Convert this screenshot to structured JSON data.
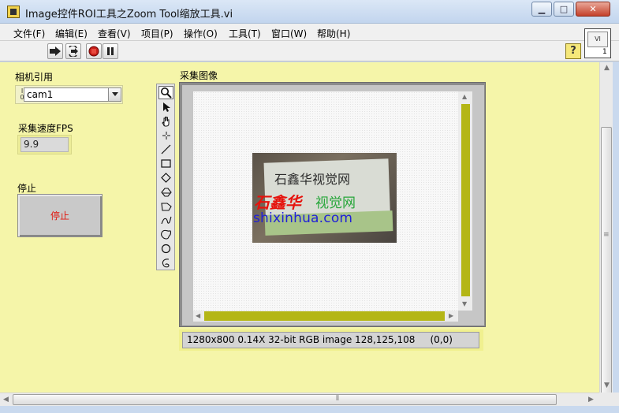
{
  "window": {
    "title": "Image控件ROI工具之Zoom Tool缩放工具.vi",
    "minimize": "▁",
    "maximize": "□",
    "close": "✕"
  },
  "menu": [
    {
      "label": "文件(F)"
    },
    {
      "label": "编辑(E)"
    },
    {
      "label": "查看(V)"
    },
    {
      "label": "项目(P)"
    },
    {
      "label": "操作(O)"
    },
    {
      "label": "工具(T)"
    },
    {
      "label": "窗口(W)"
    },
    {
      "label": "帮助(H)"
    }
  ],
  "toolbar": {
    "help_label": "?",
    "icons": [
      "run-arrow-icon",
      "run-continuously-icon",
      "abort-execution-icon",
      "pause-icon"
    ],
    "vi_icon_text": "1"
  },
  "controls": {
    "camera_label": "相机引用",
    "camera_io": "I/O",
    "camera_value": "cam1",
    "fps_label": "采集速度FPS",
    "fps_value": "9.9",
    "stop_label": "停止",
    "stop_button_text": "停止"
  },
  "display": {
    "label": "采集图像",
    "status": "1280x800 0.14X 32-bit RGB image 128,125,108     (0,0)",
    "palette_tools": [
      "zoom-icon",
      "pointer-icon",
      "pan-icon",
      "point-icon",
      "line-icon",
      "rectangle-icon",
      "rotated-rectangle-icon",
      "annulus-icon",
      "polygon-icon",
      "freehand-line-icon",
      "freehand-region-icon",
      "oval-icon",
      "broken-line-icon"
    ],
    "selected_tool": "zoom-icon",
    "photo_text_top": "石鑫华视觉网",
    "photo_text_mid_red": "石鑫华",
    "photo_text_mid_green": "视觉网",
    "photo_text_web": "shixinhua.com"
  },
  "colors": {
    "panel_bg": "#f5f5a9",
    "scroll_thumb": "#b4b616",
    "stop_text": "#e0180f"
  }
}
